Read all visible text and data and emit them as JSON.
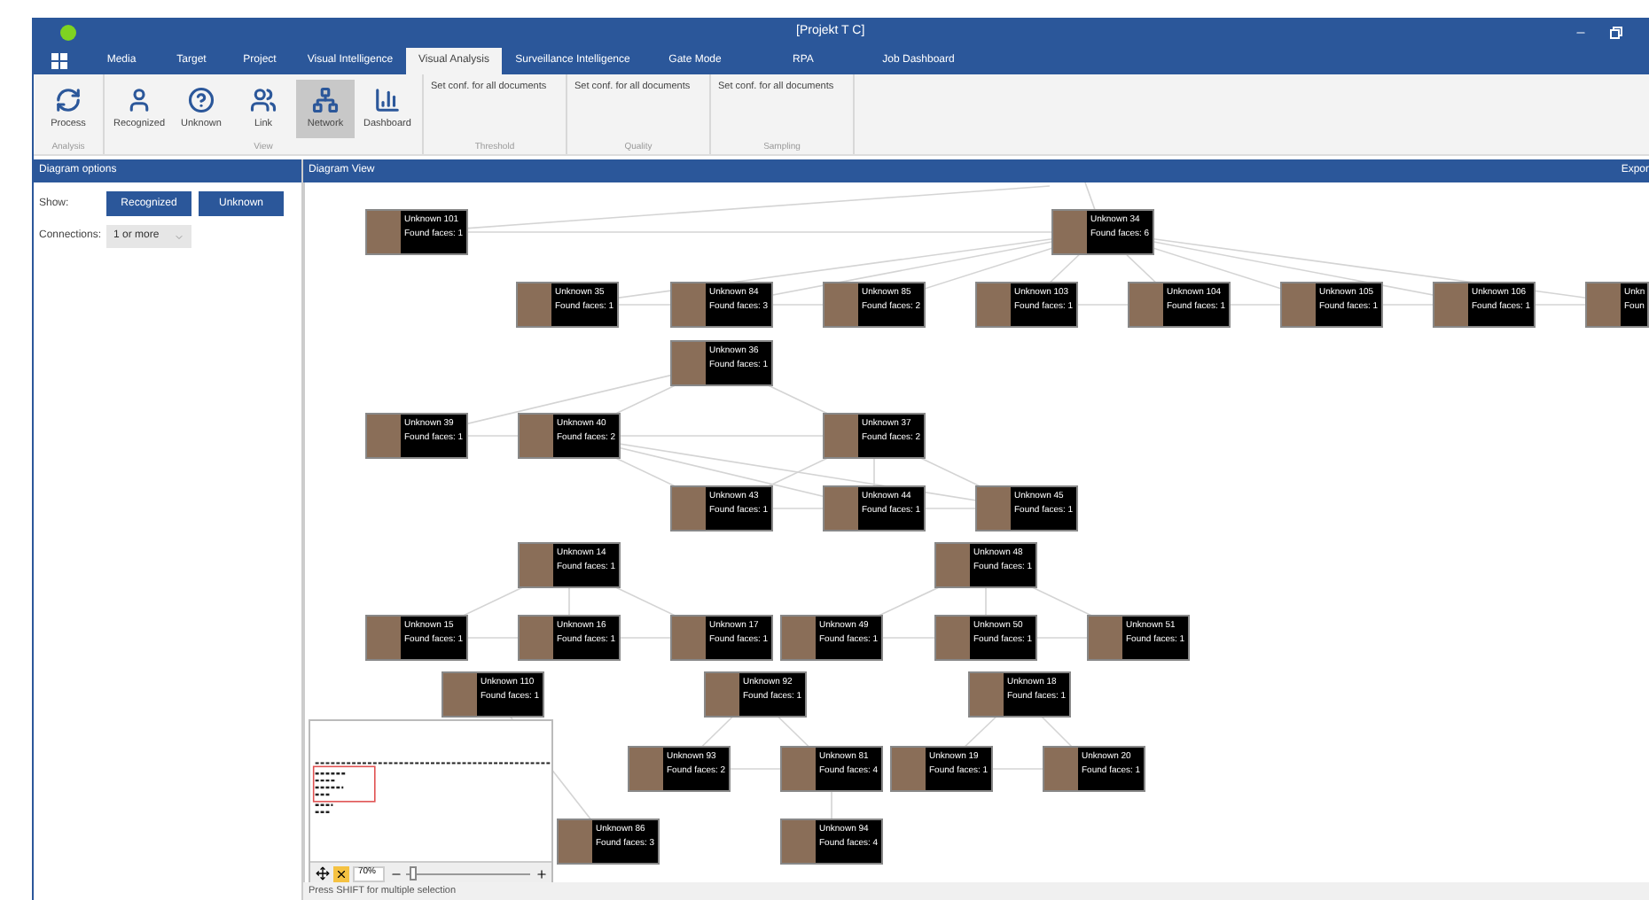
{
  "window": {
    "title": "[Projekt T C]"
  },
  "tabs": [
    {
      "label": "Media",
      "selected": false
    },
    {
      "label": "Target",
      "selected": false
    },
    {
      "label": "Project",
      "selected": false
    },
    {
      "label": "Visual Intelligence",
      "selected": false
    },
    {
      "label": "Visual Analysis",
      "selected": true
    },
    {
      "label": "Surveillance Intelligence",
      "selected": false
    },
    {
      "label": "Gate Mode",
      "selected": false
    },
    {
      "label": "RPA",
      "selected": false
    },
    {
      "label": "Job Dashboard",
      "selected": false
    }
  ],
  "ribbon": [
    {
      "kind": "buttons",
      "label": "Analysis",
      "buttons": [
        {
          "label": "Process",
          "kind": "process",
          "selected": false
        }
      ]
    },
    {
      "kind": "buttons",
      "label": "View",
      "buttons": [
        {
          "label": "Recognized",
          "kind": "person",
          "selected": false
        },
        {
          "label": "Unknown",
          "kind": "unknown",
          "selected": false
        },
        {
          "label": "Link",
          "kind": "group",
          "selected": false
        },
        {
          "label": "Network",
          "kind": "network",
          "selected": true
        },
        {
          "label": "Dashboard",
          "kind": "bars",
          "selected": false
        }
      ]
    },
    {
      "kind": "text",
      "label": "Threshold",
      "text": "Set conf. for all documents"
    },
    {
      "kind": "text",
      "label": "Quality",
      "text": "Set conf. for all documents"
    },
    {
      "kind": "text",
      "label": "Sampling",
      "text": "Set conf. for all documents"
    }
  ],
  "options": {
    "title": "Diagram options",
    "show_label": "Show:",
    "show_buttons": [
      "Recognized",
      "Unknown"
    ],
    "connections_label": "Connections:",
    "connections_value": "1 or more"
  },
  "diagram": {
    "title": "Diagram View",
    "export": "Expor",
    "nodes": [
      {
        "name": "Unknown 101",
        "faces": "Found faces: 1"
      },
      {
        "name": "Unknown 34",
        "faces": "Found faces: 6"
      },
      {
        "name": "Unknown 35",
        "faces": "Found faces: 1"
      },
      {
        "name": "Unknown 84",
        "faces": "Found faces: 3"
      },
      {
        "name": "Unknown 85",
        "faces": "Found faces: 2"
      },
      {
        "name": "Unknown 103",
        "faces": "Found faces: 1"
      },
      {
        "name": "Unknown 104",
        "faces": "Found faces: 1"
      },
      {
        "name": "Unknown 105",
        "faces": "Found faces: 1"
      },
      {
        "name": "Unknown 106",
        "faces": "Found faces: 1"
      },
      {
        "name": "Unkn",
        "faces": "Foun"
      },
      {
        "name": "Unknown 36",
        "faces": "Found faces: 1"
      },
      {
        "name": "Unknown 39",
        "faces": "Found faces: 1"
      },
      {
        "name": "Unknown 40",
        "faces": "Found faces: 2"
      },
      {
        "name": "Unknown 37",
        "faces": "Found faces: 2"
      },
      {
        "name": "Unknown 43",
        "faces": "Found faces: 1"
      },
      {
        "name": "Unknown 44",
        "faces": "Found faces: 1"
      },
      {
        "name": "Unknown 45",
        "faces": "Found faces: 1"
      },
      {
        "name": "Unknown 14",
        "faces": "Found faces: 1"
      },
      {
        "name": "Unknown 48",
        "faces": "Found faces: 1"
      },
      {
        "name": "Unknown 15",
        "faces": "Found faces: 1"
      },
      {
        "name": "Unknown 16",
        "faces": "Found faces: 1"
      },
      {
        "name": "Unknown 17",
        "faces": "Found faces: 1"
      },
      {
        "name": "Unknown 49",
        "faces": "Found faces: 1"
      },
      {
        "name": "Unknown 50",
        "faces": "Found faces: 1"
      },
      {
        "name": "Unknown 51",
        "faces": "Found faces: 1"
      },
      {
        "name": "Unknown 110",
        "faces": "Found faces: 1"
      },
      {
        "name": "Unknown 92",
        "faces": "Found faces: 1"
      },
      {
        "name": "Unknown 18",
        "faces": "Found faces: 1"
      },
      {
        "name": "Unknown 93",
        "faces": "Found faces: 2"
      },
      {
        "name": "Unknown 81",
        "faces": "Found faces: 4"
      },
      {
        "name": "Unknown 19",
        "faces": "Found faces: 1"
      },
      {
        "name": "Unknown 20",
        "faces": "Found faces: 1"
      },
      {
        "name": "Unknown 86",
        "faces": "Found faces: 3"
      },
      {
        "name": "Unknown 94",
        "faces": "Found faces: 4"
      }
    ],
    "minimap": {
      "zoom": "70%",
      "level": 0.05
    }
  },
  "status_bar": "Press SHIFT for multiple selection"
}
